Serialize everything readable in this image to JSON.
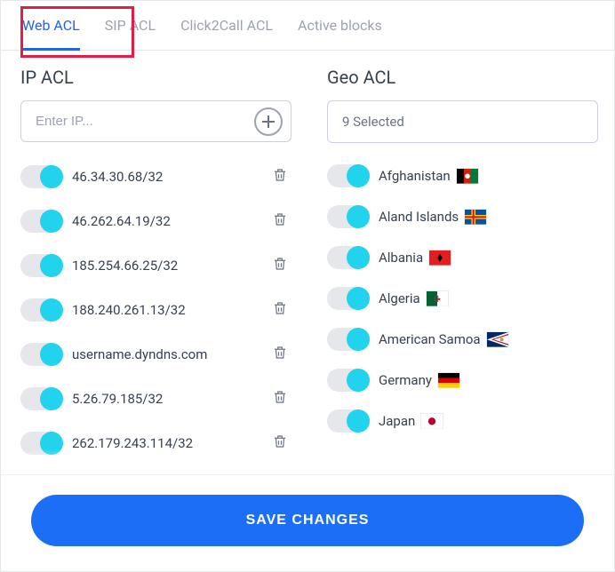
{
  "tabs": [
    {
      "label": "Web ACL",
      "active": true
    },
    {
      "label": "SIP ACL",
      "active": false
    },
    {
      "label": "Click2Call ACL",
      "active": false
    },
    {
      "label": "Active blocks",
      "active": false
    }
  ],
  "ip_acl": {
    "title": "IP ACL",
    "input_placeholder": "Enter IP...",
    "items": [
      {
        "label": "46.34.30.68/32",
        "on": true
      },
      {
        "label": "46.262.64.19/32",
        "on": true
      },
      {
        "label": "185.254.66.25/32",
        "on": true
      },
      {
        "label": "188.240.261.13/32",
        "on": true
      },
      {
        "label": "username.dyndns.com",
        "on": true
      },
      {
        "label": "5.26.79.185/32",
        "on": true
      },
      {
        "label": "262.179.243.114/32",
        "on": true
      }
    ]
  },
  "geo_acl": {
    "title": "Geo ACL",
    "selected_text": "9 Selected",
    "items": [
      {
        "label": "Afghanistan",
        "on": true,
        "flag": "af"
      },
      {
        "label": "Aland Islands",
        "on": true,
        "flag": "ax"
      },
      {
        "label": "Albania",
        "on": true,
        "flag": "al"
      },
      {
        "label": "Algeria",
        "on": true,
        "flag": "dz"
      },
      {
        "label": "American Samoa",
        "on": true,
        "flag": "as"
      },
      {
        "label": "Germany",
        "on": true,
        "flag": "de"
      },
      {
        "label": "Japan",
        "on": true,
        "flag": "jp"
      }
    ]
  },
  "save_label": "SAVE CHANGES",
  "flags": {
    "af": "<svg viewBox='0 0 26 18'><rect width='8.67' height='18' fill='#000'/><rect x='8.67' width='8.67' height='18' fill='#d32011'/><rect x='17.33' width='8.67' height='18' fill='#007a36'/><circle cx='13' cy='9' r='3' fill='#fff'/></svg>",
    "ax": "<svg viewBox='0 0 26 18'><rect width='26' height='18' fill='#0053a5'/><rect x='8' width='5' height='18' fill='#ffce00'/><rect y='6.5' width='26' height='5' fill='#ffce00'/><rect x='9.5' width='2' height='18' fill='#d21034'/><rect y='8' width='26' height='2' fill='#d21034'/></svg>",
    "al": "<svg viewBox='0 0 26 18'><rect width='26' height='18' fill='#e41e20'/><path d='M13 4l-3 5 3 5 3-5z' fill='#000'/></svg>",
    "dz": "<svg viewBox='0 0 26 18'><rect width='13' height='18' fill='#006233'/><rect x='13' width='13' height='18' fill='#fff'/><circle cx='13' cy='9' r='4' fill='#d21034'/><circle cx='14.5' cy='9' r='3.3' fill='#fff'/><circle cx='13.8' cy='9' r='3.3' fill='#006233' clip-path='inset(0 50% 0 0)'/><path d='M15 7l.6 1.8h1.9l-1.5 1.1.6 1.8L15 10.6l-1.5 1.1.6-1.8L12.6 8.8h1.9z' fill='#d21034'/></svg>",
    "as": "<svg viewBox='0 0 26 18'><rect width='26' height='18' fill='#002868'/><path d='M26 0L0 9l26 9z' fill='#fff'/><path d='M26 2L5 9l21 7z' fill='#bd1021'/><path d='M26 3.5L8 9l18 5.5z' fill='#fff'/><circle cx='18' cy='9' r='2.2' fill='#c09a5b'/></svg>",
    "de": "<svg viewBox='0 0 26 18'><rect width='26' height='6' fill='#000'/><rect y='6' width='26' height='6' fill='#dd0000'/><rect y='12' width='26' height='6' fill='#ffce00'/></svg>",
    "jp": "<svg viewBox='0 0 26 18'><rect width='26' height='18' fill='#fff'/><circle cx='13' cy='9' r='4.5' fill='#bc002d'/></svg>"
  }
}
